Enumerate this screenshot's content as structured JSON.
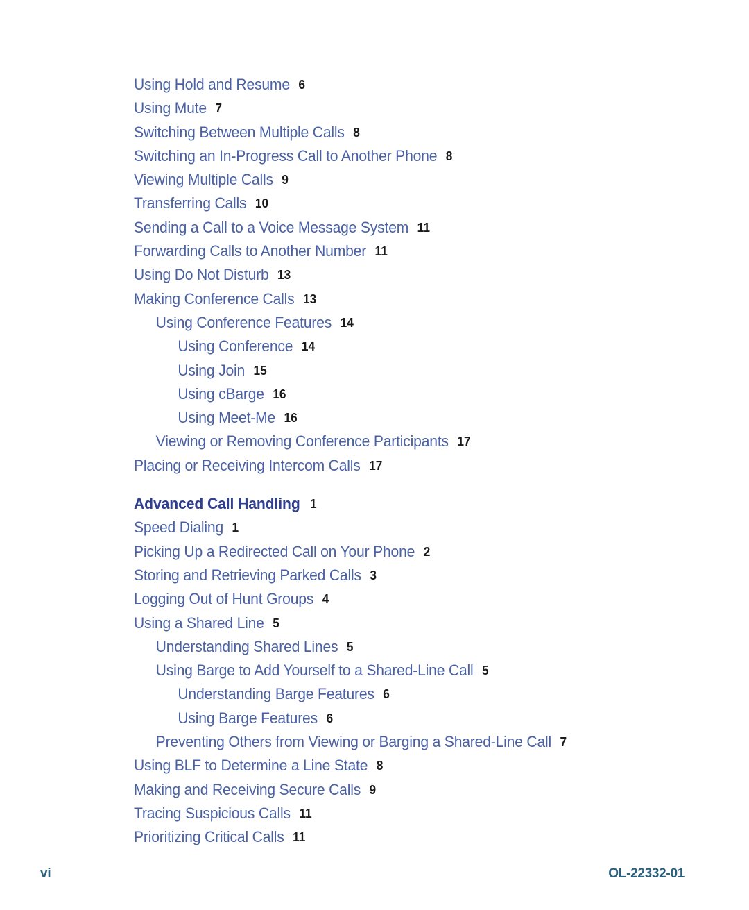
{
  "document": {
    "page_label": "vi",
    "doc_number": "OL-22332-01"
  },
  "colors": {
    "entry_text": "#4a61a4",
    "heading_text": "#2f3f91",
    "page_number": "#1a1a1a",
    "footer_text": "#2b607f",
    "background": "#ffffff"
  },
  "toc": {
    "entries": [
      {
        "label": "Using Hold and Resume",
        "page": "6",
        "level": 0,
        "heading": false,
        "gap_before": false
      },
      {
        "label": "Using Mute",
        "page": "7",
        "level": 0,
        "heading": false,
        "gap_before": false
      },
      {
        "label": "Switching Between Multiple Calls",
        "page": "8",
        "level": 0,
        "heading": false,
        "gap_before": false
      },
      {
        "label": "Switching an In-Progress Call to Another Phone",
        "page": "8",
        "level": 0,
        "heading": false,
        "gap_before": false
      },
      {
        "label": "Viewing Multiple Calls",
        "page": "9",
        "level": 0,
        "heading": false,
        "gap_before": false
      },
      {
        "label": "Transferring Calls",
        "page": "10",
        "level": 0,
        "heading": false,
        "gap_before": false
      },
      {
        "label": "Sending a Call to a Voice Message System",
        "page": "11",
        "level": 0,
        "heading": false,
        "gap_before": false
      },
      {
        "label": "Forwarding Calls to Another Number",
        "page": "11",
        "level": 0,
        "heading": false,
        "gap_before": false
      },
      {
        "label": "Using Do Not Disturb",
        "page": "13",
        "level": 0,
        "heading": false,
        "gap_before": false
      },
      {
        "label": "Making Conference Calls",
        "page": "13",
        "level": 0,
        "heading": false,
        "gap_before": false
      },
      {
        "label": "Using Conference Features",
        "page": "14",
        "level": 1,
        "heading": false,
        "gap_before": false
      },
      {
        "label": "Using Conference",
        "page": "14",
        "level": 2,
        "heading": false,
        "gap_before": false
      },
      {
        "label": "Using Join",
        "page": "15",
        "level": 2,
        "heading": false,
        "gap_before": false
      },
      {
        "label": "Using cBarge",
        "page": "16",
        "level": 2,
        "heading": false,
        "gap_before": false
      },
      {
        "label": "Using Meet-Me",
        "page": "16",
        "level": 2,
        "heading": false,
        "gap_before": false
      },
      {
        "label": "Viewing or Removing Conference Participants",
        "page": "17",
        "level": 1,
        "heading": false,
        "gap_before": false
      },
      {
        "label": "Placing or Receiving Intercom Calls",
        "page": "17",
        "level": 0,
        "heading": false,
        "gap_before": false
      },
      {
        "label": "Advanced Call Handling",
        "page": "1",
        "level": 0,
        "heading": true,
        "gap_before": true
      },
      {
        "label": "Speed Dialing",
        "page": "1",
        "level": 0,
        "heading": false,
        "gap_before": false
      },
      {
        "label": "Picking Up a Redirected Call on Your Phone",
        "page": "2",
        "level": 0,
        "heading": false,
        "gap_before": false
      },
      {
        "label": "Storing and Retrieving Parked Calls",
        "page": "3",
        "level": 0,
        "heading": false,
        "gap_before": false
      },
      {
        "label": "Logging Out of Hunt Groups",
        "page": "4",
        "level": 0,
        "heading": false,
        "gap_before": false
      },
      {
        "label": "Using a Shared Line",
        "page": "5",
        "level": 0,
        "heading": false,
        "gap_before": false
      },
      {
        "label": "Understanding Shared Lines",
        "page": "5",
        "level": 1,
        "heading": false,
        "gap_before": false
      },
      {
        "label": "Using Barge to Add Yourself to a Shared-Line Call",
        "page": "5",
        "level": 1,
        "heading": false,
        "gap_before": false
      },
      {
        "label": "Understanding Barge Features",
        "page": "6",
        "level": 2,
        "heading": false,
        "gap_before": false
      },
      {
        "label": "Using Barge Features",
        "page": "6",
        "level": 2,
        "heading": false,
        "gap_before": false
      },
      {
        "label": "Preventing Others from Viewing or Barging a Shared-Line Call",
        "page": "7",
        "level": 1,
        "heading": false,
        "gap_before": false
      },
      {
        "label": "Using BLF to Determine a Line State",
        "page": "8",
        "level": 0,
        "heading": false,
        "gap_before": false
      },
      {
        "label": "Making and Receiving Secure Calls",
        "page": "9",
        "level": 0,
        "heading": false,
        "gap_before": false
      },
      {
        "label": "Tracing Suspicious Calls",
        "page": "11",
        "level": 0,
        "heading": false,
        "gap_before": false
      },
      {
        "label": "Prioritizing Critical Calls",
        "page": "11",
        "level": 0,
        "heading": false,
        "gap_before": false
      }
    ]
  }
}
